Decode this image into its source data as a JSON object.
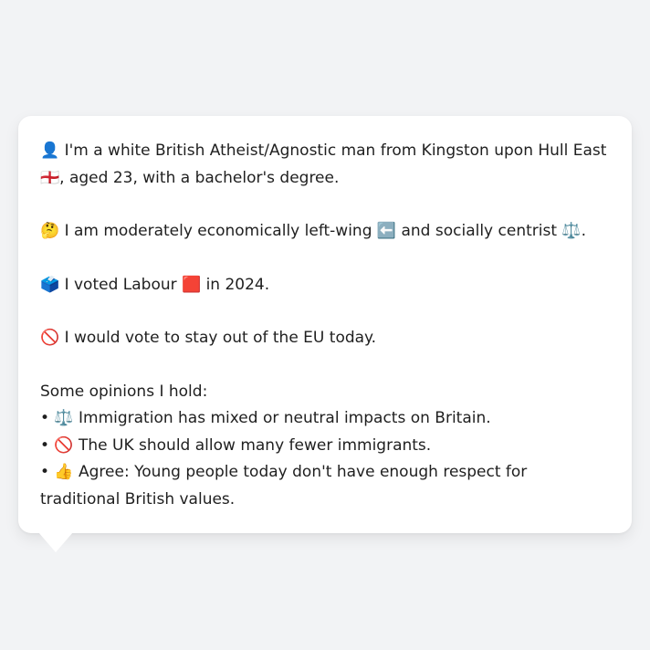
{
  "profile": {
    "identity": "👤 I'm a white British Atheist/Agnostic man from Kingston upon Hull East 🏴󠁧󠁢󠁥󠁮󠁧󠁿, aged 23, with a bachelor's degree.",
    "politics": "🤔 I am moderately economically left-wing ⬅️ and socially centrist ⚖️.",
    "vote": "🗳️ I voted Labour 🟥 in 2024.",
    "eu": "🚫 I would vote to stay out of the EU today.",
    "opinions_heading": "Some opinions I hold:",
    "opinions": [
      "• ⚖️ Immigration has mixed or neutral impacts on Britain.",
      "• 🚫 The UK should allow many fewer immigrants.",
      "• 👍 Agree: Young people today don't have enough respect for traditional British values."
    ]
  }
}
